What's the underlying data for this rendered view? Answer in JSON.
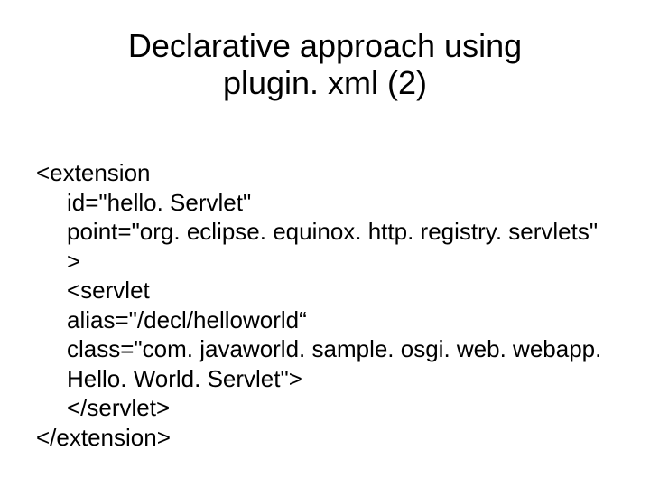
{
  "title_line1": "Declarative approach using",
  "title_line2": "plugin. xml (2)",
  "code": {
    "l01": "<extension",
    "l02": "id=\"hello. Servlet\"",
    "l03": "point=\"org. eclipse. equinox. http. registry. servlets\"",
    "l04": ">",
    "l05": "<servlet",
    "l06": "alias=\"/decl/helloworld“",
    "l07": "class=\"com. javaworld. sample. osgi. web. webapp.",
    "l08": "Hello. World. Servlet\">",
    "l09": "</servlet>",
    "l10": "</extension>"
  }
}
